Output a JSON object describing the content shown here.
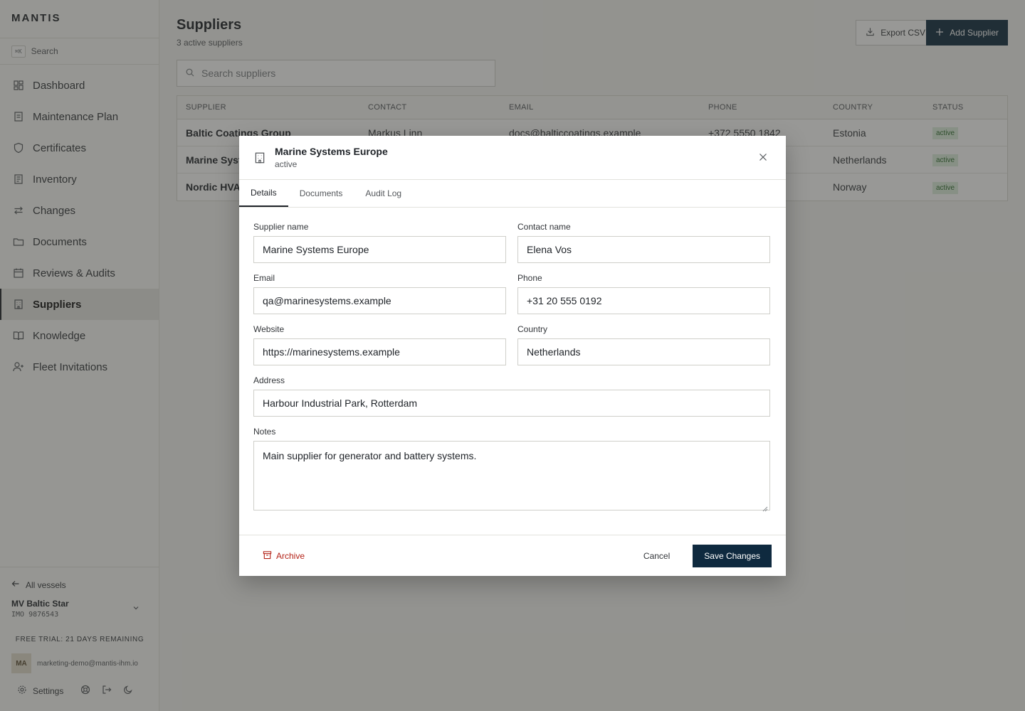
{
  "app": {
    "brand": "MANTIS"
  },
  "sidebar": {
    "search_shortcut": "⌘K",
    "search_label": "Search",
    "items": [
      {
        "label": "Dashboard"
      },
      {
        "label": "Maintenance Plan"
      },
      {
        "label": "Certificates"
      },
      {
        "label": "Inventory"
      },
      {
        "label": "Changes"
      },
      {
        "label": "Documents"
      },
      {
        "label": "Reviews & Audits"
      },
      {
        "label": "Suppliers"
      },
      {
        "label": "Knowledge"
      },
      {
        "label": "Fleet Invitations"
      }
    ],
    "all_vessels": "All vessels",
    "vessel_name": "MV Baltic Star",
    "vessel_imo": "IMO 9876543",
    "trial": "FREE TRIAL: 21 DAYS REMAINING",
    "user_initials": "MA",
    "user_email": "marketing-demo@mantis-ihm.io",
    "settings_label": "Settings"
  },
  "page": {
    "title": "Suppliers",
    "subtitle": "3 active suppliers",
    "export_label": "Export CSV",
    "add_label": "Add Supplier",
    "search_placeholder": "Search suppliers"
  },
  "table": {
    "headers": [
      "SUPPLIER",
      "CONTACT",
      "EMAIL",
      "PHONE",
      "COUNTRY",
      "STATUS"
    ],
    "rows": [
      {
        "supplier": "Baltic Coatings Group",
        "contact": "Markus Linn",
        "email": "docs@balticcoatings.example",
        "phone": "+372 5550 1842",
        "country": "Estonia",
        "status": "active"
      },
      {
        "supplier": "Marine Syst",
        "contact": "",
        "email": "",
        "phone": "",
        "country": "Netherlands",
        "status": "active"
      },
      {
        "supplier": "Nordic HVA",
        "contact": "",
        "email": "",
        "phone": "",
        "country": "Norway",
        "status": "active"
      }
    ]
  },
  "modal": {
    "title": "Marine Systems Europe",
    "status": "active",
    "tabs": [
      "Details",
      "Documents",
      "Audit Log"
    ],
    "fields": {
      "supplier_name": {
        "label": "Supplier name",
        "value": "Marine Systems Europe"
      },
      "contact_name": {
        "label": "Contact name",
        "value": "Elena Vos"
      },
      "email": {
        "label": "Email",
        "value": "qa@marinesystems.example"
      },
      "phone": {
        "label": "Phone",
        "value": "+31 20 555 0192"
      },
      "website": {
        "label": "Website",
        "value": "https://marinesystems.example"
      },
      "country": {
        "label": "Country",
        "value": "Netherlands"
      },
      "address": {
        "label": "Address",
        "value": "Harbour Industrial Park, Rotterdam"
      },
      "notes": {
        "label": "Notes",
        "value": "Main supplier for generator and battery systems."
      }
    },
    "archive_label": "Archive",
    "cancel_label": "Cancel",
    "save_label": "Save Changes"
  },
  "colors": {
    "primary": "#0f2a3f",
    "danger": "#b42318",
    "badge_bg": "#dcefdc",
    "badge_text": "#2d6b2d"
  }
}
